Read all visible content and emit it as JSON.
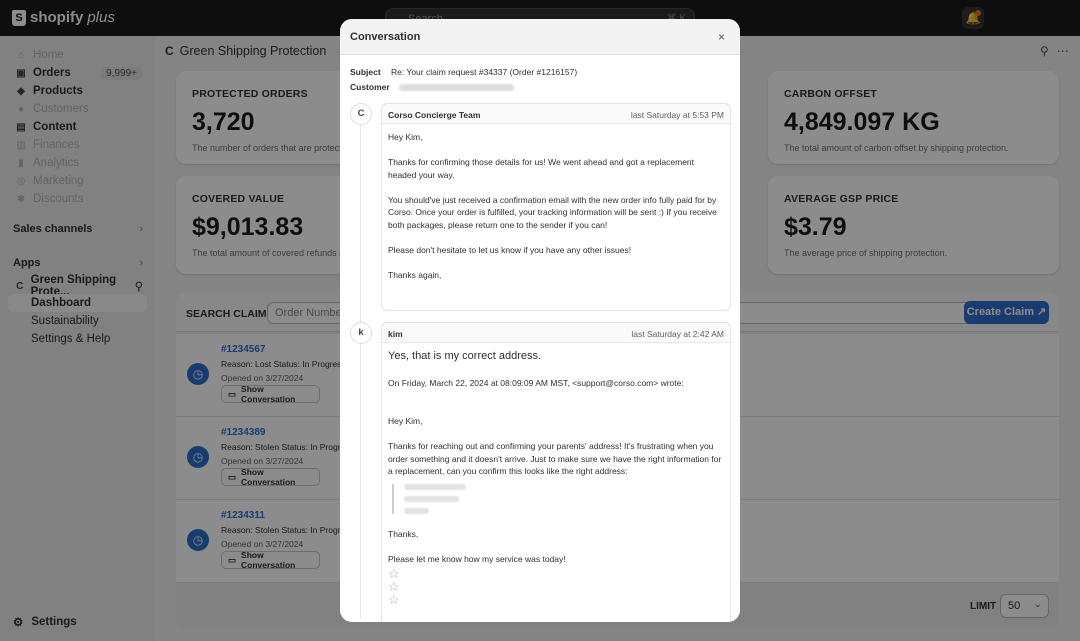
{
  "topbar": {
    "brand": "shopify",
    "brand_suffix": "plus",
    "search_placeholder": "Search",
    "search_shortcut": "⌘ K"
  },
  "sidebar": {
    "items": [
      {
        "label": "Home",
        "icon": "home-icon",
        "dim": true
      },
      {
        "label": "Orders",
        "icon": "orders-icon",
        "badge": "9,999+"
      },
      {
        "label": "Products",
        "icon": "tag-icon"
      },
      {
        "label": "Customers",
        "icon": "person-icon",
        "dim": true
      },
      {
        "label": "Content",
        "icon": "content-icon"
      },
      {
        "label": "Finances",
        "icon": "bank-icon",
        "dim": true
      },
      {
        "label": "Analytics",
        "icon": "chart-icon",
        "dim": true
      },
      {
        "label": "Marketing",
        "icon": "target-icon",
        "dim": true
      },
      {
        "label": "Discounts",
        "icon": "discount-icon",
        "dim": true
      }
    ],
    "sales_channels": "Sales channels",
    "apps": "Apps",
    "app_name": "Green Shipping Prote...",
    "app_sub": [
      "Dashboard",
      "Sustainability",
      "Settings & Help"
    ],
    "settings": "Settings"
  },
  "page": {
    "title": "Green Shipping Protection"
  },
  "stats": [
    {
      "label": "PROTECTED ORDERS",
      "value": "3,720",
      "desc": "The number of orders that are protected"
    },
    {
      "label": "CARBON OFFSET",
      "value": "4,849.097 KG",
      "desc": "The total amount of carbon offset by shipping protection."
    },
    {
      "label": "COVERED VALUE",
      "value": "$9,013.83",
      "desc": "The total amount of covered refunds and"
    },
    {
      "label": "AVERAGE GSP PRICE",
      "value": "$3.79",
      "desc": "The average price of shipping protection."
    }
  ],
  "claims": {
    "title": "SEARCH CLAIMS",
    "search_placeholder": "Order Number o",
    "create_label": "Create Claim",
    "show_conversation": "Show Conversation",
    "rows": [
      {
        "number": "#1234567",
        "meta": "Reason: Lost   Status: In Progres",
        "opened": "Opened on 3/27/2024"
      },
      {
        "number": "#1234389",
        "meta": "Reason: Stolen   Status: In Progre",
        "opened": "Opened on 3/27/2024"
      },
      {
        "number": "#1234311",
        "meta": "Reason: Stolen   Status: In Progre",
        "opened": "Opened on 3/27/2024"
      }
    ],
    "limit_label": "LIMIT",
    "limit_value": "50"
  },
  "modal": {
    "title": "Conversation",
    "subject_label": "Subject",
    "subject": "Re: Your claim request #34337 (Order #1216157)",
    "customer_label": "Customer",
    "messages": [
      {
        "author": "Corso Concierge Team",
        "avatar": "C",
        "time": "last Saturday at 5:53 PM",
        "paragraphs": [
          "Hey Kim,",
          "Thanks for confirming those details for us! We went ahead and got a replacement headed your way.",
          "You should've just received a confirmation email with the new order info fully paid for by Corso. Once your order is fulfilled, your tracking information will be sent :) If you receive both packages, please return one to the sender if you can!",
          "Please don't hesitate to let us know if you have any other issues!",
          "Thanks again,"
        ]
      },
      {
        "author": "kim",
        "avatar": "k",
        "time": "last Saturday at 2:42 AM",
        "headline": "Yes, that is my correct address.",
        "paragraphs": [
          "On Friday, March 22, 2024 at 08:09:09 AM MST,  <support@corso.com> wrote:",
          "Hey Kim,",
          "Thanks for reaching out and confirming your parents' address! It's frustrating when you order something and it doesn't arrive. Just to make sure we have the right information for a replacement, can you confirm this looks like the right address:",
          "Thanks,",
          "Please let me know how my service was today!"
        ]
      }
    ]
  }
}
